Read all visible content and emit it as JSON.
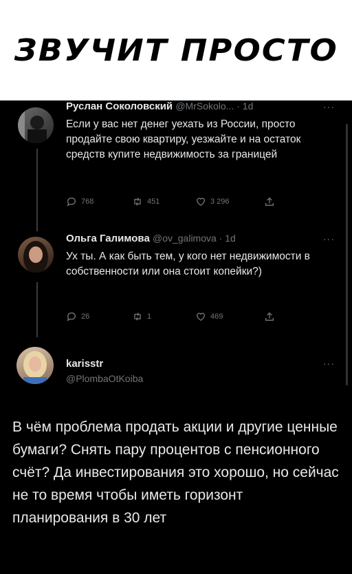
{
  "caption": "ЗВУЧИТ ПРОСТО",
  "tweets": [
    {
      "name": "Руслан Соколовский",
      "meta": "@MrSokolo... · 1d",
      "text": "Если у вас нет денег уехать из России, просто продайте свою квартиру, уезжайте и на остаток средств купите недвижимость за границей",
      "replies": "768",
      "retweets": "451",
      "likes": "3 296"
    },
    {
      "name": "Ольга Галимова",
      "meta": "@ov_galimova · 1d",
      "text": "Ух ты. А как быть тем, у кого нет недвижимости в собственности или она стоит копейки?)",
      "replies": "26",
      "retweets": "1",
      "likes": "469"
    }
  ],
  "main": {
    "name": "karisstr",
    "handle": "@PlombaOtKoiba",
    "text": "В чём проблема продать акции и другие ценные бумаги? Снять пару процентов с пенсионного счёт? Да инвестирования это хорошо, но сейчас не то время чтобы иметь горизонт планирования в 30 лет"
  },
  "menu": "···"
}
